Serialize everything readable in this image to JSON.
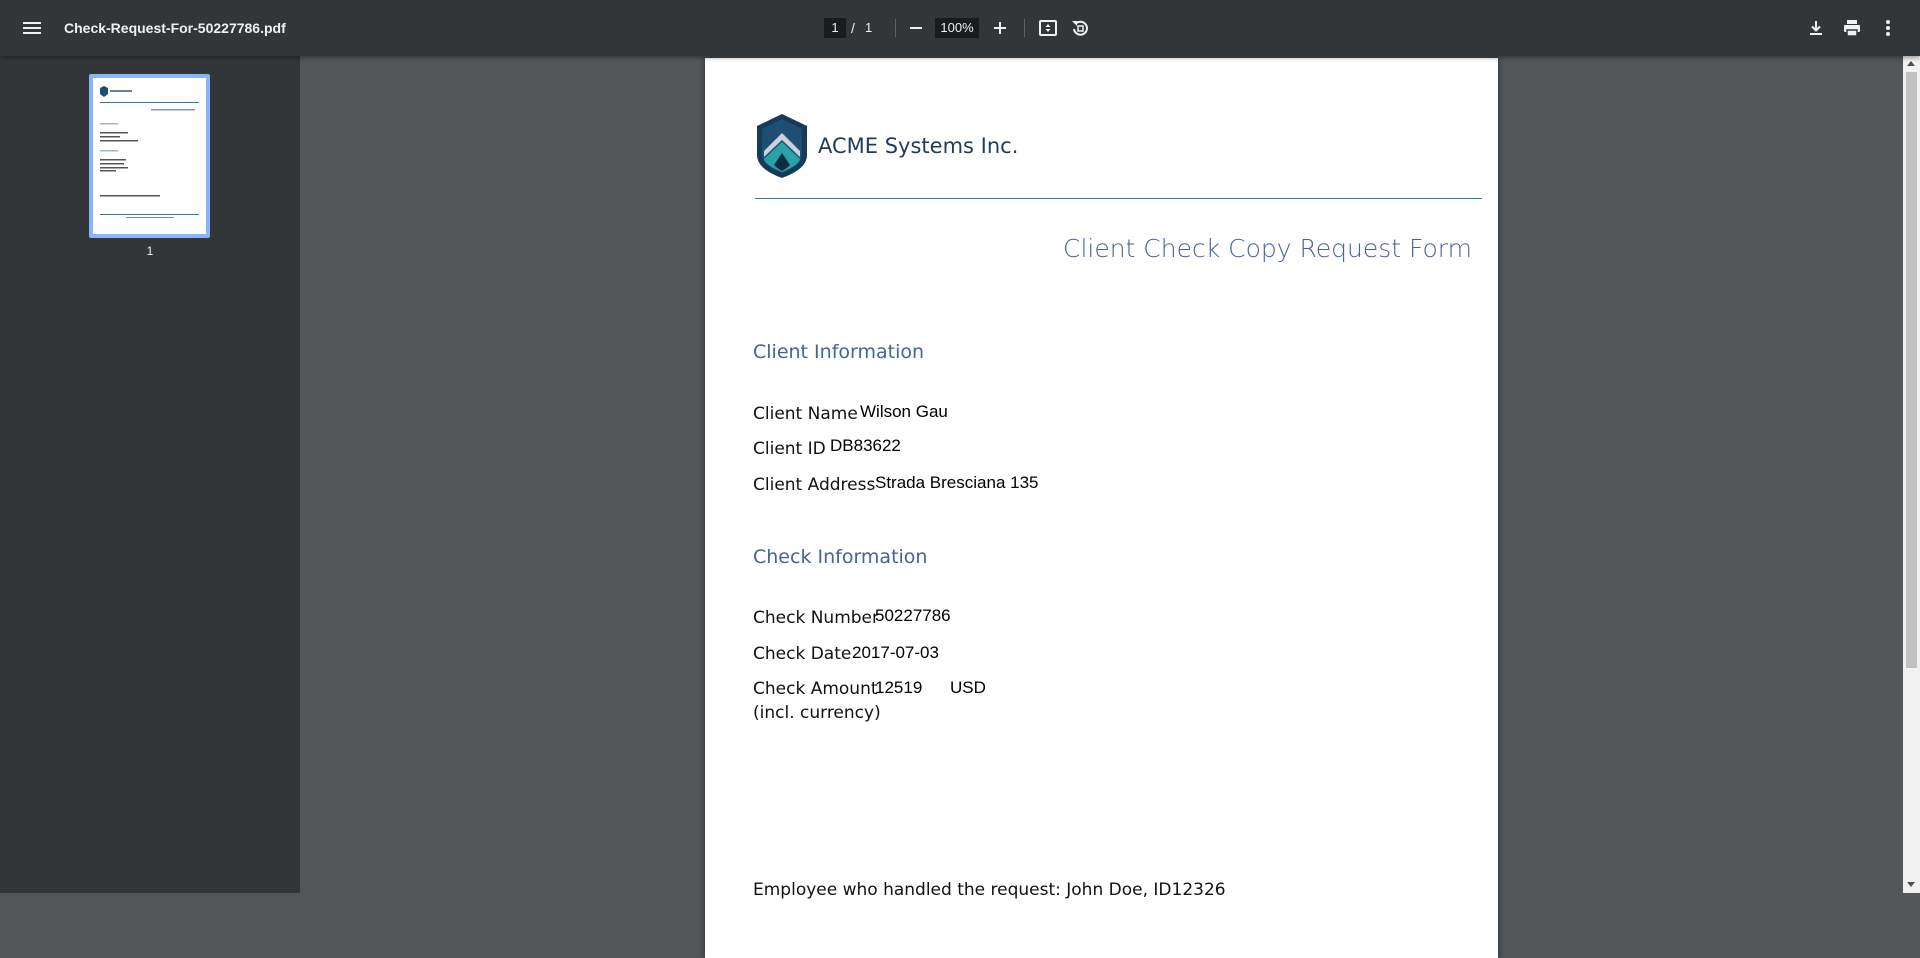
{
  "toolbar": {
    "file_name": "Check-Request-For-50227786.pdf",
    "current_page": "1",
    "page_separator": "/",
    "total_pages": "1",
    "zoom": "100%"
  },
  "sidebar": {
    "thumbnails": [
      {
        "page_label": "1"
      }
    ]
  },
  "document": {
    "company_name": "ACME Systems Inc.",
    "form_title": "Client Check Copy Request Form",
    "client_section": {
      "title": "Client Information",
      "name_label": "Client Name",
      "name_value": "Wilson Gau",
      "id_label": "Client ID",
      "id_value": "DB83622",
      "address_label": "Client Address",
      "address_value": "Strada Bresciana 135"
    },
    "check_section": {
      "title": "Check Information",
      "number_label": "Check Number",
      "number_value": "50227786",
      "date_label": "Check Date",
      "date_value": "2017-07-03",
      "amount_label": "Check Amount",
      "amount_label_sub": "(incl. currency)",
      "amount_value": "12519",
      "currency_value": "USD"
    },
    "employee_line": "Employee who handled the request: John Doe, ID12326"
  },
  "colors": {
    "toolbar_bg": "#323639",
    "viewer_bg": "#525659",
    "heading_blue": "#44649a",
    "thumb_highlight": "#8ab4f8"
  },
  "icons": {
    "menu": "menu-icon",
    "zoom_out": "minus-icon",
    "zoom_in": "plus-icon",
    "fit": "fit-to-page-icon",
    "rotate": "rotate-icon",
    "download": "download-icon",
    "print": "print-icon",
    "more": "more-vert-icon"
  }
}
